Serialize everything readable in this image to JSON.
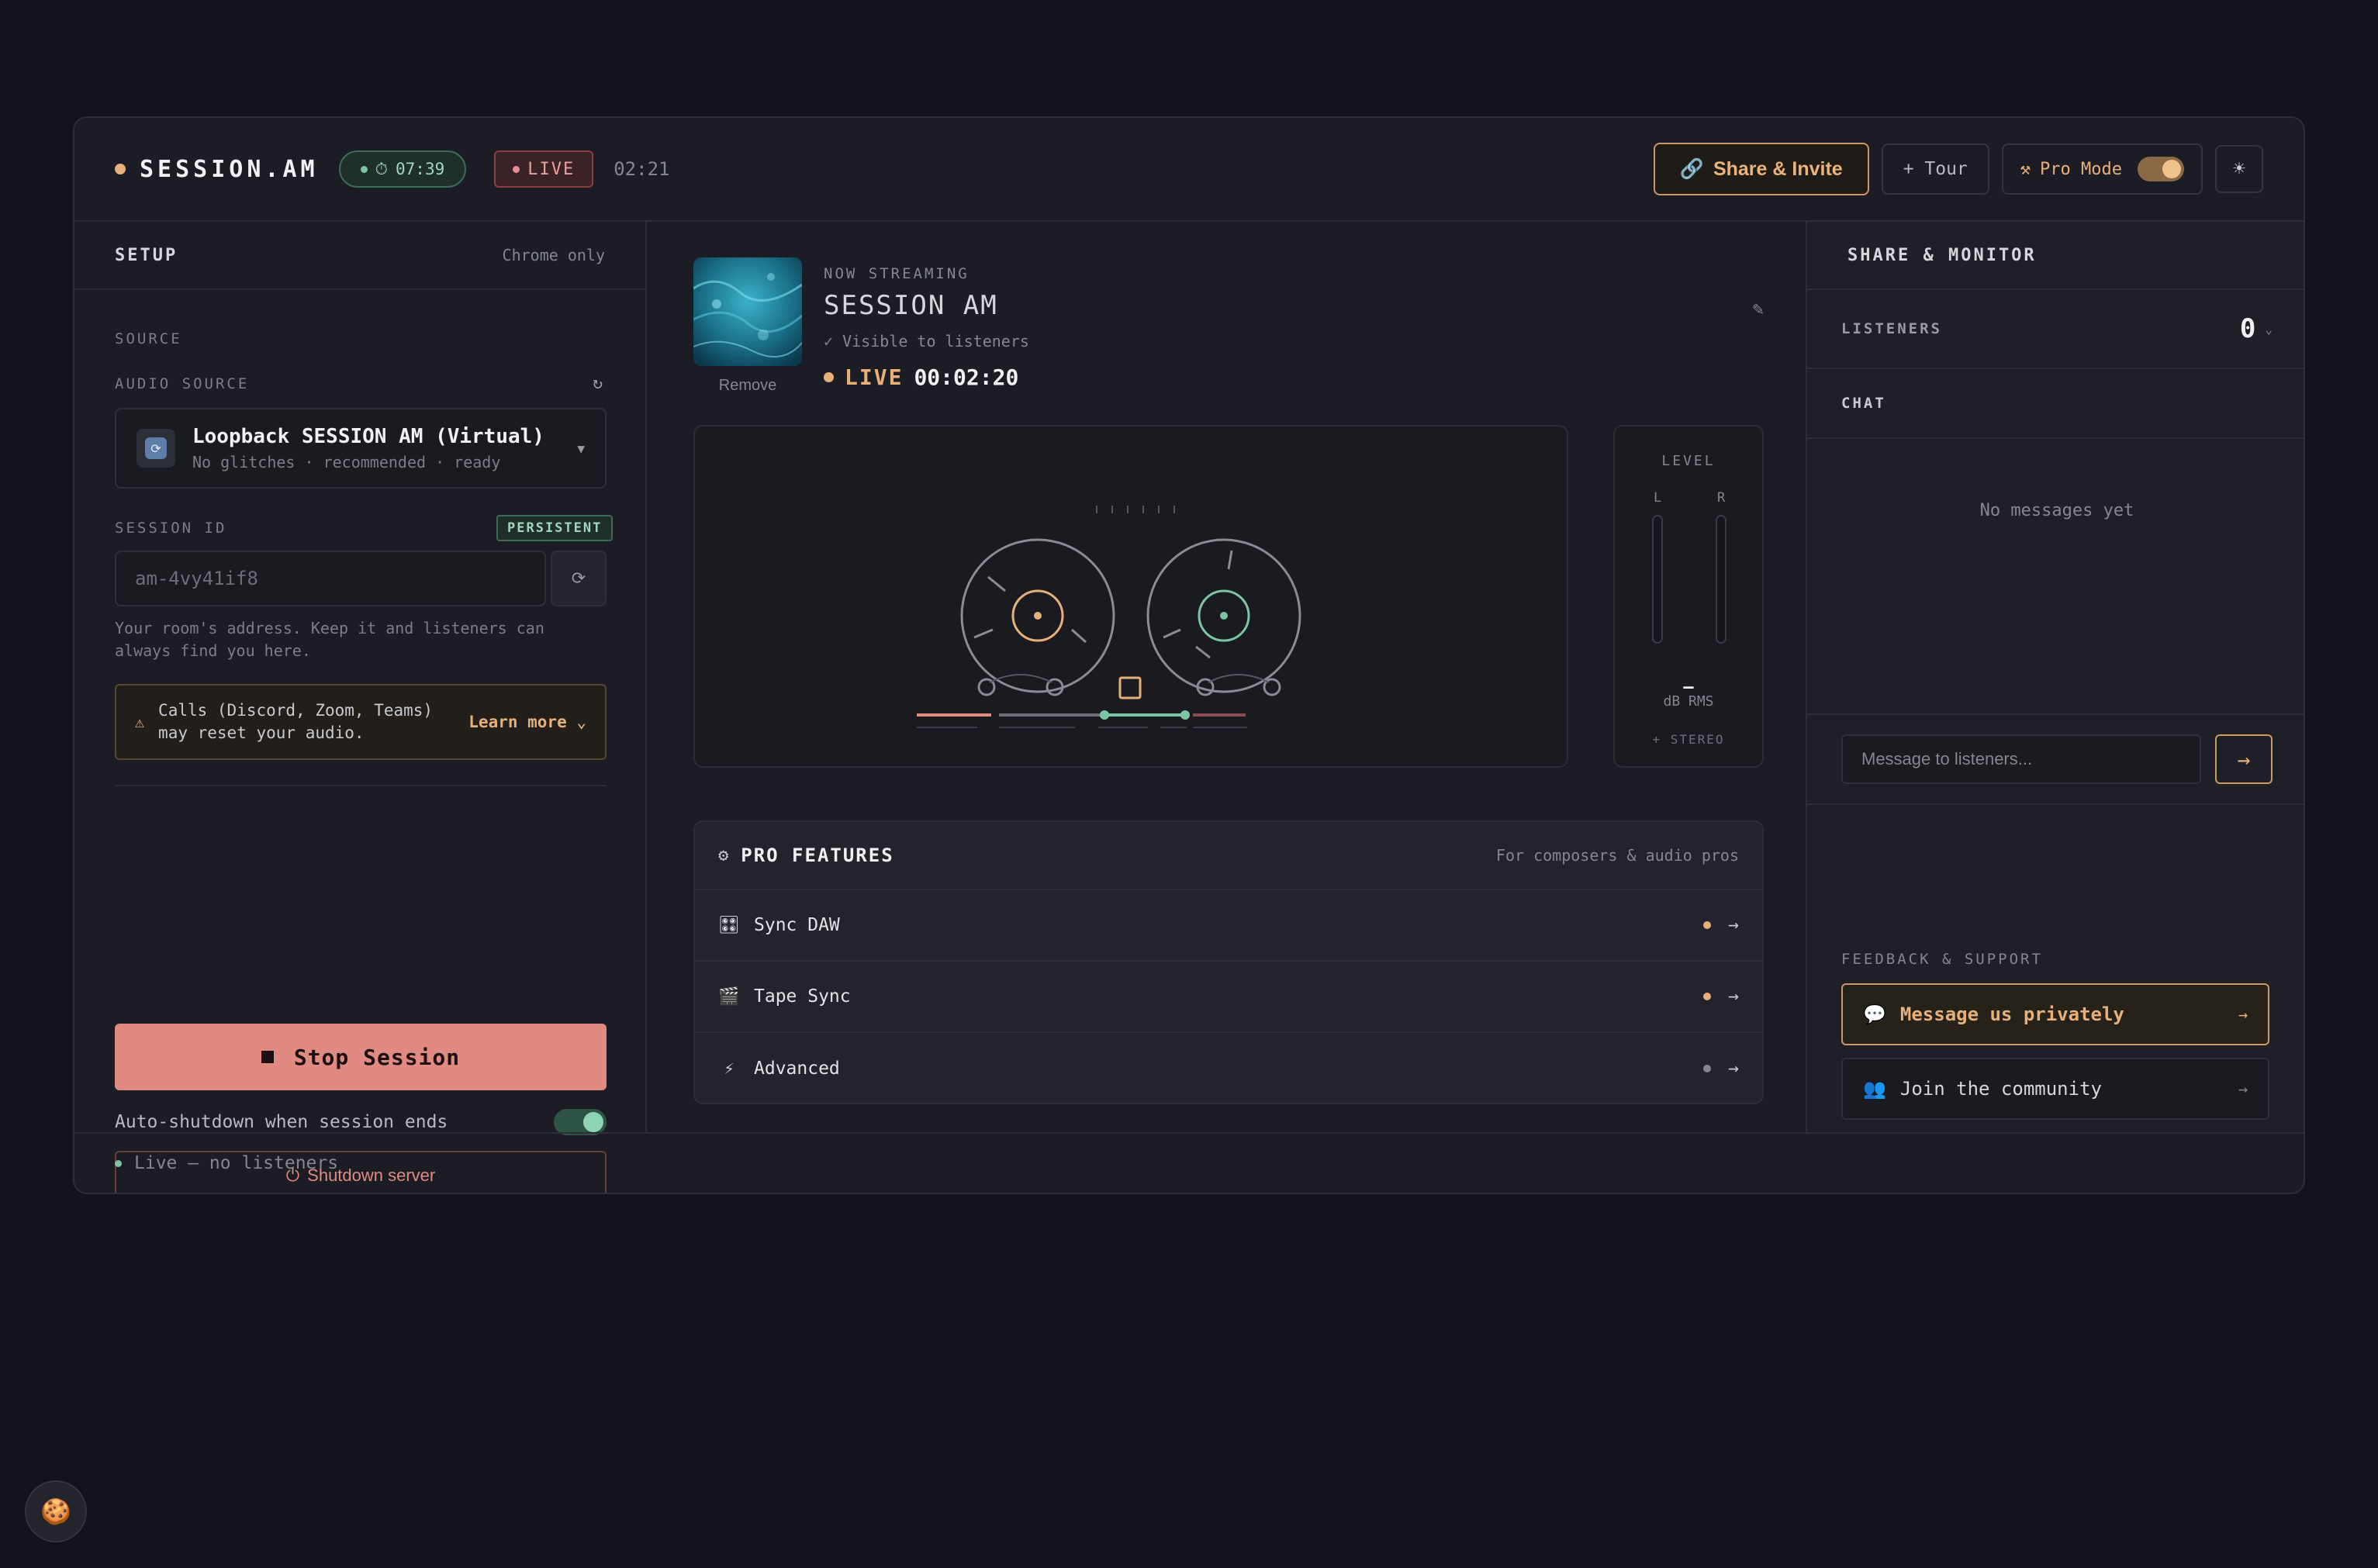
{
  "header": {
    "brand": "SESSION.AM",
    "timer": "07:39",
    "live_badge": "LIVE",
    "elapsed": "02:21",
    "share_label": "Share & Invite",
    "tour_label": "+ Tour",
    "pro_mode_label": "Pro Mode",
    "pro_mode_on": true
  },
  "setup": {
    "title": "SETUP",
    "browser_note": "Chrome only",
    "source_label": "SOURCE",
    "audio_source_label": "AUDIO SOURCE",
    "audio_source_name": "Loopback SESSION AM (Virtual)",
    "audio_source_sub": "No glitches · recommended · ready",
    "session_id_label": "SESSION ID",
    "persistent_badge": "PERSISTENT",
    "session_id_value": "am-4vy41if8",
    "help_text": "Your room's address. Keep it and listeners can always find you here.",
    "warning_text": "Calls (Discord, Zoom, Teams) may reset your audio.",
    "learn_more": "Learn more ⌄",
    "stop_label": "Stop Session",
    "auto_shutdown_label": "Auto-shutdown when session ends",
    "auto_shutdown_on": true,
    "shutdown_label": "Shutdown server"
  },
  "stream": {
    "remove_label": "Remove",
    "now_label": "NOW STREAMING",
    "title": "SESSION AM",
    "visibility": "✓ Visible to listeners",
    "live_word": "LIVE",
    "live_time": "00:02:20"
  },
  "level": {
    "title": "LEVEL",
    "left": "L",
    "right": "R",
    "db_value": "—",
    "db_label": "dB RMS",
    "stereo": "+ STEREO"
  },
  "pro_features": {
    "title": "PRO FEATURES",
    "subtitle": "For composers & audio pros",
    "items": [
      {
        "label": "Sync DAW",
        "icon": "daw-grid-icon",
        "dot_color": "#e6b07a"
      },
      {
        "label": "Tape Sync",
        "icon": "clapper-icon",
        "dot_color": "#e6b07a"
      },
      {
        "label": "Advanced",
        "icon": "lightning-icon",
        "dot_color": "#86868f"
      }
    ]
  },
  "monitor": {
    "title": "SHARE & MONITOR",
    "listeners_label": "LISTENERS",
    "listeners_count": "0",
    "chat_label": "CHAT",
    "chat_empty": "No messages yet",
    "chat_placeholder": "Message to listeners...",
    "feedback_label": "FEEDBACK & SUPPORT",
    "message_privately": "Message us privately",
    "join_community": "Join the community"
  },
  "footer": {
    "status": "Live — no listeners"
  },
  "colors": {
    "accent": "#e6b07a",
    "live_green": "#7cc4a4",
    "stop_red": "#e08a82"
  }
}
